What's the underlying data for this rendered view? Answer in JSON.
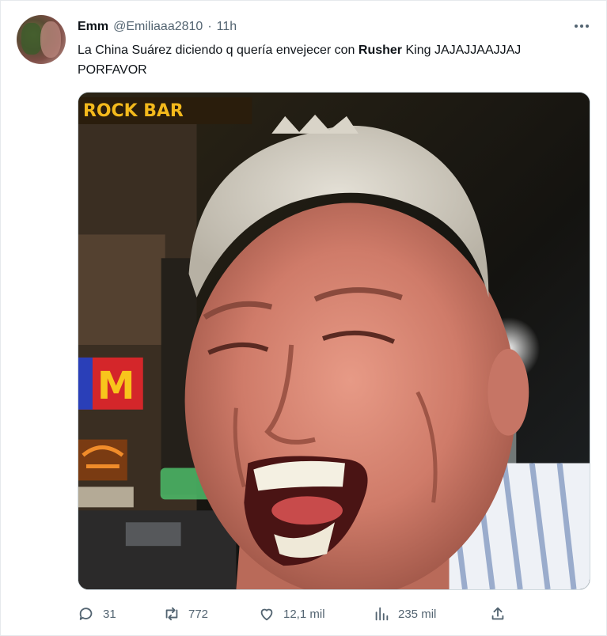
{
  "tweet": {
    "author": {
      "name": "Emm",
      "handle": "@Emiliaaa2810",
      "separator": "·",
      "time": "11h"
    },
    "text": {
      "part1": "La China Suárez diciendo q quería envejecer con ",
      "bold": "Rusher",
      "part2": " King JAJAJJAAJJAJ PORFAVOR"
    },
    "media": {
      "sign_top": "ROCK BAR",
      "sign_mcd": "M"
    },
    "actions": {
      "replies": "31",
      "retweets": "772",
      "likes": "12,1 mil",
      "views": "235 mil"
    },
    "icons": {
      "more": "more-icon",
      "reply": "reply-icon",
      "retweet": "retweet-icon",
      "like": "heart-icon",
      "views": "views-icon",
      "share": "share-icon"
    },
    "colors": {
      "text": "#0f1419",
      "secondary": "#536471",
      "border": "#cfd9de"
    }
  }
}
